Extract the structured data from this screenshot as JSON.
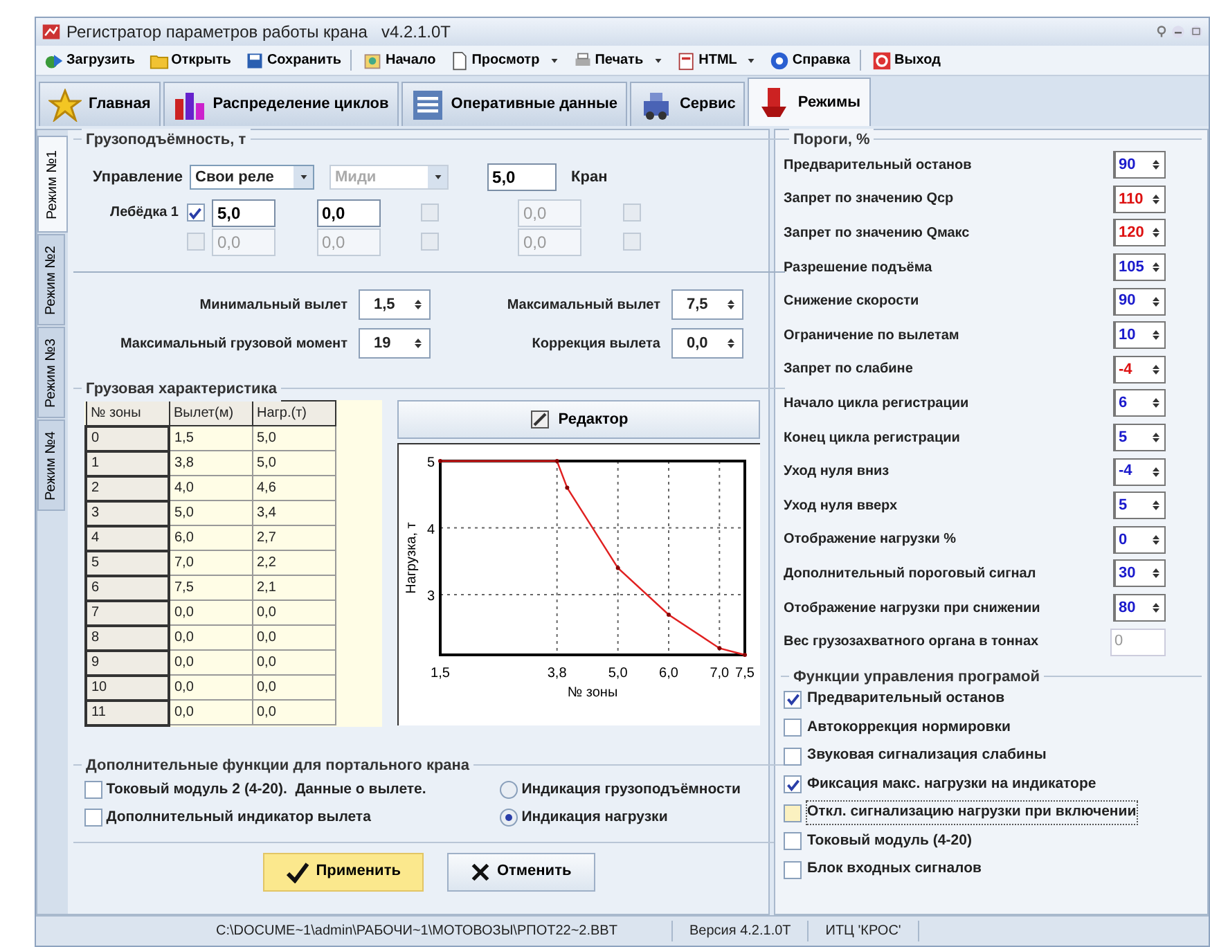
{
  "window": {
    "title": "Регистратор параметров работы крана   v4.2.1.0T"
  },
  "toolbar": [
    {
      "label": "Загрузить",
      "dropdown": false
    },
    {
      "label": "Открыть",
      "dropdown": false
    },
    {
      "label": "Сохранить",
      "dropdown": false,
      "separator_after": true
    },
    {
      "label": "Начало",
      "dropdown": false
    },
    {
      "label": "Просмотр",
      "dropdown": true
    },
    {
      "label": "Печать",
      "dropdown": true
    },
    {
      "label": "HTML",
      "dropdown": true
    },
    {
      "label": "Справка",
      "dropdown": false,
      "separator_after": true
    },
    {
      "label": "Выход",
      "dropdown": false
    }
  ],
  "tabs": [
    {
      "label": "Главная",
      "selected": false
    },
    {
      "label": "Распределение циклов",
      "selected": false
    },
    {
      "label": "Оперативные данные",
      "selected": false
    },
    {
      "label": "Сервис",
      "selected": false
    },
    {
      "label": "Режимы",
      "selected": true
    }
  ],
  "mode_tabs": [
    {
      "label": "Режим №1",
      "selected": true
    },
    {
      "label": "Режим №2",
      "selected": false
    },
    {
      "label": "Режим №3",
      "selected": false
    },
    {
      "label": "Режим №4",
      "selected": false
    }
  ],
  "capacity": {
    "title": "Грузоподъёмность, т",
    "control_label": "Управление",
    "control_combo": {
      "value": "Свои реле",
      "disabled": false
    },
    "second_combo": {
      "value": "Миди",
      "disabled": true
    },
    "crane_value": "5,0",
    "crane_label": "Кран",
    "winch_rows": [
      {
        "label": "Лебёдка 1",
        "cells": [
          {
            "kind": "check",
            "checked": true,
            "disabled": false
          },
          {
            "kind": "field",
            "value": "5,0",
            "disabled": false
          },
          {
            "kind": "field",
            "value": "0,0",
            "disabled": false
          },
          {
            "kind": "check",
            "checked": false,
            "disabled": true
          },
          {
            "kind": "gap"
          },
          {
            "kind": "field",
            "value": "0,0",
            "disabled": true
          },
          {
            "kind": "check",
            "checked": false,
            "disabled": true
          }
        ]
      },
      {
        "cells": [
          {
            "kind": "check",
            "checked": false,
            "disabled": true
          },
          {
            "kind": "field",
            "value": "0,0",
            "disabled": true
          },
          {
            "kind": "field",
            "value": "0,0",
            "disabled": true
          },
          {
            "kind": "check",
            "checked": false,
            "disabled": true
          },
          {
            "kind": "gap"
          },
          {
            "kind": "field",
            "value": "0,0",
            "disabled": true
          },
          {
            "kind": "check",
            "checked": false,
            "disabled": true
          }
        ]
      }
    ]
  },
  "reach": [
    {
      "label": "Минимальный вылет",
      "value": "1,5"
    },
    {
      "label": "Максимальный вылет",
      "value": "7,5"
    },
    {
      "label": "Максимальный грузовой момент",
      "value": "19"
    },
    {
      "label": "Коррекция вылета",
      "value": "0,0"
    }
  ],
  "load_chart_group": {
    "title": "Грузовая характеристика",
    "table": {
      "columns": [
        "№ зоны",
        "Вылет(м)",
        "Нагр.(т)"
      ],
      "rows": [
        [
          "0",
          "1,5",
          "5,0"
        ],
        [
          "1",
          "3,8",
          "5,0"
        ],
        [
          "2",
          "4,0",
          "4,6"
        ],
        [
          "3",
          "5,0",
          "3,4"
        ],
        [
          "4",
          "6,0",
          "2,7"
        ],
        [
          "5",
          "7,0",
          "2,2"
        ],
        [
          "6",
          "7,5",
          "2,1"
        ],
        [
          "7",
          "0,0",
          "0,0"
        ],
        [
          "8",
          "0,0",
          "0,0"
        ],
        [
          "9",
          "0,0",
          "0,0"
        ],
        [
          "10",
          "0,0",
          "0,0"
        ],
        [
          "11",
          "0,0",
          "0,0"
        ]
      ]
    },
    "editor_button": "Редактор",
    "chart_data": {
      "type": "line",
      "xlabel": "№ зоны",
      "ylabel": "Нагрузка, т",
      "x": [
        1.5,
        3.8,
        4.0,
        5.0,
        6.0,
        7.0,
        7.5
      ],
      "grid": true,
      "series": [
        {
          "color": "#e02020",
          "marker": "circle",
          "values": [
            5,
            5,
            4.6,
            3.4,
            2.7,
            2.2,
            2.1
          ]
        }
      ],
      "xlim": [
        1.5,
        7.5
      ],
      "ylim": [
        2.1,
        5
      ],
      "xticks": [
        {
          "value": 1.5,
          "label": "1,5"
        },
        {
          "value": 3.8,
          "label": "3,8"
        },
        {
          "value": 5.0,
          "label": "5,0"
        },
        {
          "value": 6.0,
          "label": "6,0"
        },
        {
          "value": 7.0,
          "label": "7,0"
        },
        {
          "value": 7.5,
          "label": "7,5"
        }
      ],
      "yticks": [
        3,
        4,
        5
      ]
    }
  },
  "portal": {
    "title": "Дополнительные функции для портального крана",
    "checks": [
      {
        "label": "Токовый модуль 2 (4-20).  Данные о вылете.",
        "checked": false
      },
      {
        "label": "Дополнительный индикатор вылета",
        "checked": false
      }
    ],
    "radios": [
      {
        "label": "Индикация грузоподъёмности",
        "selected": false
      },
      {
        "label": "Индикация нагрузки",
        "selected": true
      }
    ]
  },
  "buttons": [
    {
      "label": "Применить",
      "highlighted": true
    },
    {
      "label": "Отменить",
      "highlighted": false
    }
  ],
  "thresholds": {
    "title": "Пороги, %",
    "items": [
      {
        "label": "Предварительный останов",
        "value": "90",
        "color": "#1a1acc",
        "disabled": false
      },
      {
        "label": "Запрет по значению Qср",
        "value": "110",
        "color": "#dd1111",
        "disabled": false
      },
      {
        "label": "Запрет по значению Qмакс",
        "value": "120",
        "color": "#dd1111",
        "disabled": false
      },
      {
        "label": "Разрешение подъёма",
        "value": "105",
        "color": "#1a1acc",
        "disabled": false
      },
      {
        "label": "Снижение скорости",
        "value": "90",
        "color": "#1a1acc",
        "disabled": false
      },
      {
        "label": "Ограничение по вылетам",
        "value": "10",
        "color": "#1a1acc",
        "disabled": false
      },
      {
        "label": "Запрет по слабине",
        "value": "-4",
        "color": "#dd1111",
        "disabled": false
      },
      {
        "label": "Начало цикла регистрации",
        "value": "6",
        "color": "#1a1acc",
        "disabled": false
      },
      {
        "label": "Конец цикла регистрации",
        "value": "5",
        "color": "#1a1acc",
        "disabled": false
      },
      {
        "label": "Уход нуля вниз",
        "value": "-4",
        "color": "#1a1acc",
        "disabled": false
      },
      {
        "label": "Уход нуля вверх",
        "value": "5",
        "color": "#1a1acc",
        "disabled": false
      },
      {
        "label": "Отображение нагрузки %",
        "value": "0",
        "color": "#1a1acc",
        "disabled": false
      },
      {
        "label": "Дополнительный пороговый сигнал",
        "value": "30",
        "color": "#1a1acc",
        "disabled": false
      },
      {
        "label": "Отображение нагрузки при снижении",
        "value": "80",
        "color": "#1a1acc",
        "disabled": false
      },
      {
        "label": "Вес грузозахватного органа в тоннах",
        "value": "0",
        "color": "#999999",
        "disabled": true
      }
    ]
  },
  "functions": {
    "title": "Функции управления програмой",
    "items": [
      {
        "label": "Предварительный останов",
        "checked": true,
        "focused": false
      },
      {
        "label": "Автокоррекция нормировки",
        "checked": false,
        "focused": false
      },
      {
        "label": "Звуковая сигнализация слабины",
        "checked": false,
        "focused": false
      },
      {
        "label": "Фиксация макс. нагрузки на индикаторе",
        "checked": true,
        "focused": false
      },
      {
        "label": "Откл. сигнализацию нагрузки при включении",
        "checked": false,
        "focused": true
      },
      {
        "label": "Токовый модуль (4-20)",
        "checked": false,
        "focused": false
      },
      {
        "label": "Блок входных сигналов",
        "checked": false,
        "focused": false
      }
    ]
  },
  "status_bar": [
    "C:\\DOCUME~1\\admin\\РАБОЧИ~1\\МОТОВОЗЫ\\РПОТ22~2.BBT",
    "Версия 4.2.1.0T",
    "ИТЦ 'КРОС'"
  ]
}
